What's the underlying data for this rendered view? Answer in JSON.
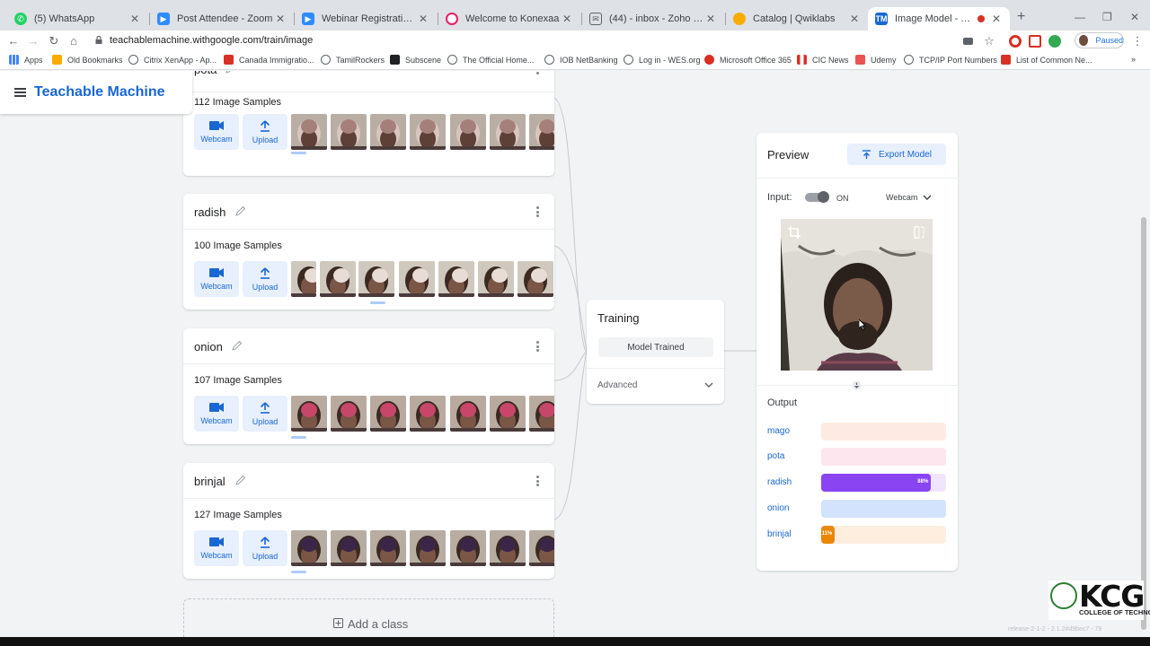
{
  "browser": {
    "tabs": [
      {
        "title": "(5) WhatsApp",
        "icon": "whatsapp-icon",
        "color": "#25d366"
      },
      {
        "title": "Post Attendee - Zoom",
        "icon": "zoom-icon",
        "color": "#2d8cff"
      },
      {
        "title": "Webinar Registration - Zoom",
        "icon": "zoom-icon",
        "color": "#2d8cff"
      },
      {
        "title": "Welcome to Konexaa",
        "icon": "konexaa-icon",
        "color": "#e91e63"
      },
      {
        "title": "(44) - inbox - Zoho Mail (shab...",
        "icon": "mail-icon",
        "color": "#5f6368"
      },
      {
        "title": "Catalog | Qwiklabs",
        "icon": "qwiklabs-icon",
        "color": "#f9ab00"
      },
      {
        "title": "Image Model - Teachable",
        "icon": "teachable-icon",
        "color": "#1967d2"
      }
    ],
    "url": "teachablemachine.withgoogle.com/train/image",
    "profile_label": "Paused",
    "bookmarks": [
      "Apps",
      "Old Bookmarks",
      "Citrix XenApp - Ap...",
      "Canada Immigratio...",
      "TamilRockers",
      "Subscene",
      "The Official Home...",
      "IOB NetBanking",
      "Log in - WES.org",
      "Microsoft Office 365",
      "CIC News",
      "Udemy",
      "TCP/IP Port Numbers",
      "List of Common Ne..."
    ]
  },
  "app": {
    "brand": "Teachable Machine"
  },
  "classes": [
    {
      "name": "pota",
      "count": "112 Image Samples",
      "webcam": "Webcam",
      "upload": "Upload",
      "thumb_style": "pota"
    },
    {
      "name": "radish",
      "count": "100 Image Samples",
      "webcam": "Webcam",
      "upload": "Upload",
      "thumb_style": "radish"
    },
    {
      "name": "onion",
      "count": "107 Image Samples",
      "webcam": "Webcam",
      "upload": "Upload",
      "thumb_style": "onion"
    },
    {
      "name": "brinjal",
      "count": "127 Image Samples",
      "webcam": "Webcam",
      "upload": "Upload",
      "thumb_style": "brinjal"
    }
  ],
  "add_class": "Add a class",
  "training": {
    "title": "Training",
    "button": "Model Trained",
    "advanced": "Advanced"
  },
  "preview": {
    "title": "Preview",
    "export": "Export Model",
    "input_label": "Input:",
    "toggle_state": "ON",
    "source": "Webcam",
    "output_title": "Output",
    "outputs": [
      {
        "label": "mago",
        "value": 0,
        "pct_text": "",
        "fill": "#f9733c",
        "track": "#fdeae2",
        "label_color": "#1967d2"
      },
      {
        "label": "pota",
        "value": 0,
        "pct_text": "",
        "fill": "#ea4c8a",
        "track": "#fde6ee",
        "label_color": "#1967d2"
      },
      {
        "label": "radish",
        "value": 0.88,
        "pct_text": "88%",
        "fill": "#8a44f1",
        "track": "#efe6fd",
        "label_color": "#1967d2"
      },
      {
        "label": "onion",
        "value": 0,
        "pct_text": "",
        "fill": "#4285f4",
        "track": "#d3e3fd",
        "label_color": "#1967d2"
      },
      {
        "label": "brinjal",
        "value": 0.11,
        "pct_text": "11%",
        "fill": "#ea8600",
        "track": "#fdeee0",
        "label_color": "#1967d2"
      }
    ]
  },
  "footer": {
    "logo_big": "KCG",
    "logo_small": "COLLEGE OF TECHNOLOGY",
    "release": "release-2-1-2 - 2.1.2#d9bec7 - 79"
  }
}
